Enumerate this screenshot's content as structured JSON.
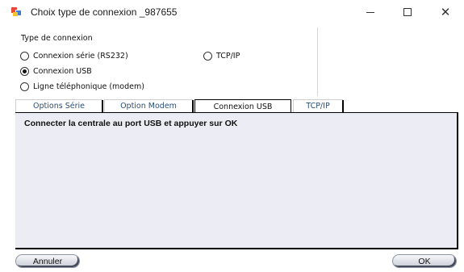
{
  "window": {
    "title": "Choix type de connexion  _987655",
    "icon": "app-windows-icon"
  },
  "group": {
    "title": "Type de connexion",
    "options": [
      {
        "label": "Connexion série (RS232)",
        "checked": false
      },
      {
        "label": "TCP/IP",
        "checked": false
      },
      {
        "label": "Connexion USB",
        "checked": true
      },
      {
        "label": "Ligne téléphonique (modem)",
        "checked": false
      }
    ]
  },
  "tabs": [
    {
      "label": "Options Série",
      "active": false
    },
    {
      "label": "Option Modem",
      "active": false
    },
    {
      "label": "Connexion USB",
      "active": true
    },
    {
      "label": "TCP/IP",
      "active": false
    }
  ],
  "panel": {
    "message": "Connecter la centrale au port USB et appuyer sur OK"
  },
  "buttons": {
    "cancel": "Annuler",
    "ok": "OK"
  },
  "colors": {
    "panel_bg": "#ecedf4",
    "tab_text": "#2a4f7a"
  }
}
